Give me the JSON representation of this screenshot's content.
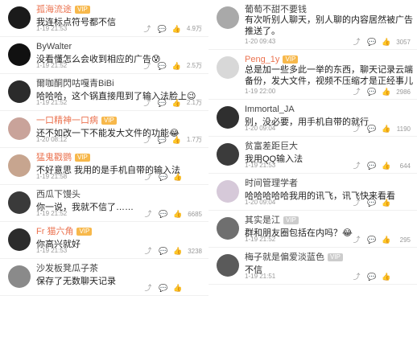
{
  "left": [
    {
      "name": "孤海流途",
      "name_color": "orange",
      "badge": "VIP",
      "text": "我连标点符号都不信",
      "time": "1-19 21:53",
      "likes": "4.9万",
      "avatar_bg": "#1b1b1b"
    },
    {
      "name": "ByWalter",
      "name_color": "gray",
      "badge": "",
      "text": "没看懂怎么会收到相应的广告😰",
      "time": "1-19 21:52",
      "likes": "2.5万",
      "avatar_bg": "#111111"
    },
    {
      "name": "爾咖酮閃咕嘎青BiBi",
      "name_color": "gray",
      "badge": "",
      "text": "哈哈哈，这个锅直接甩到了输入法脸上😉",
      "time": "1-19 21:52",
      "likes": "2.1万",
      "avatar_bg": "#2b2b2b"
    },
    {
      "name": "一口精神一口病",
      "name_color": "orange",
      "badge": "VIP",
      "text": "还不如改一下不能发大文件的功能😂",
      "time": "1-20 08:12",
      "likes": "1.7万",
      "avatar_bg": "#c9a39a"
    },
    {
      "name": "猛鬼戳鹦",
      "name_color": "orange",
      "badge": "VIP",
      "text": "不好意思 我用的是手机自带的输入法",
      "time": "1-19 21:58",
      "likes": "",
      "avatar_bg": "#c7a58f"
    },
    {
      "name": "西瓜下馒头",
      "name_color": "gray",
      "badge": "",
      "text": "你一说，我就不信了……",
      "time": "1-19 21:52",
      "likes": "6685",
      "avatar_bg": "#3a3a3a"
    },
    {
      "name": "Fr 猫六角",
      "name_color": "orange",
      "badge": "VIP",
      "text": "你高兴就好",
      "time": "1-19 21:53",
      "likes": "3238",
      "avatar_bg": "#2c2c2c"
    },
    {
      "name": "沙发板凳瓜子茶",
      "name_color": "gray",
      "badge": "",
      "text": "保存了无数聊天记录",
      "time": "",
      "likes": "",
      "avatar_bg": "#8a8a8a"
    }
  ],
  "right": [
    {
      "name": "葡萄不甜不要钱",
      "name_color": "gray",
      "badge": "",
      "text": "有次听别人聊天，别人聊的内容居然被广告推送了。",
      "time": "1-20 09:43",
      "likes": "3057",
      "avatar_bg": "#a9a9a9",
      "multi": true
    },
    {
      "name": "Peng_1y",
      "name_color": "orange",
      "badge": "VIP",
      "text": "总是加一些多此一举的东西，聊天记录云端备份，发大文件，视频不压缩才是正经事儿",
      "time": "1-19 22:00",
      "likes": "2986",
      "avatar_bg": "#d8d8d8",
      "multi": true
    },
    {
      "name": "Immortal_JA",
      "name_color": "gray",
      "badge": "",
      "text": "别，没必要，用手机自带的就行",
      "time": "1-20 09:04",
      "likes": "1190",
      "avatar_bg": "#2f2f2f"
    },
    {
      "name": "贫富差距巨大",
      "name_color": "gray",
      "badge": "",
      "text": "我用QQ输入法",
      "time": "1-19 21:53",
      "likes": "644",
      "avatar_bg": "#3b3b3b"
    },
    {
      "name": "时间管理学者",
      "name_color": "gray",
      "badge": "",
      "text": "哈哈哈哈哈我用的讯飞，讯飞快来看看",
      "time": "1-20 09:04",
      "likes": "",
      "avatar_bg": "#d6c9d9"
    },
    {
      "name": "其实是江",
      "name_color": "gray",
      "badge": "VIP",
      "text": "群和朋友圈包括在内吗？😂",
      "time": "1-19 21:52",
      "likes": "295",
      "avatar_bg": "#6f6f6f"
    },
    {
      "name": "梅子就是偏爱淡蓝色",
      "name_color": "gray",
      "badge": "VIP",
      "text": "不信",
      "time": "1-19 21:51",
      "likes": "",
      "avatar_bg": "#5a5a5a"
    }
  ],
  "icons": {
    "share": "share-icon",
    "comment": "comment-icon",
    "like": "like-icon"
  }
}
